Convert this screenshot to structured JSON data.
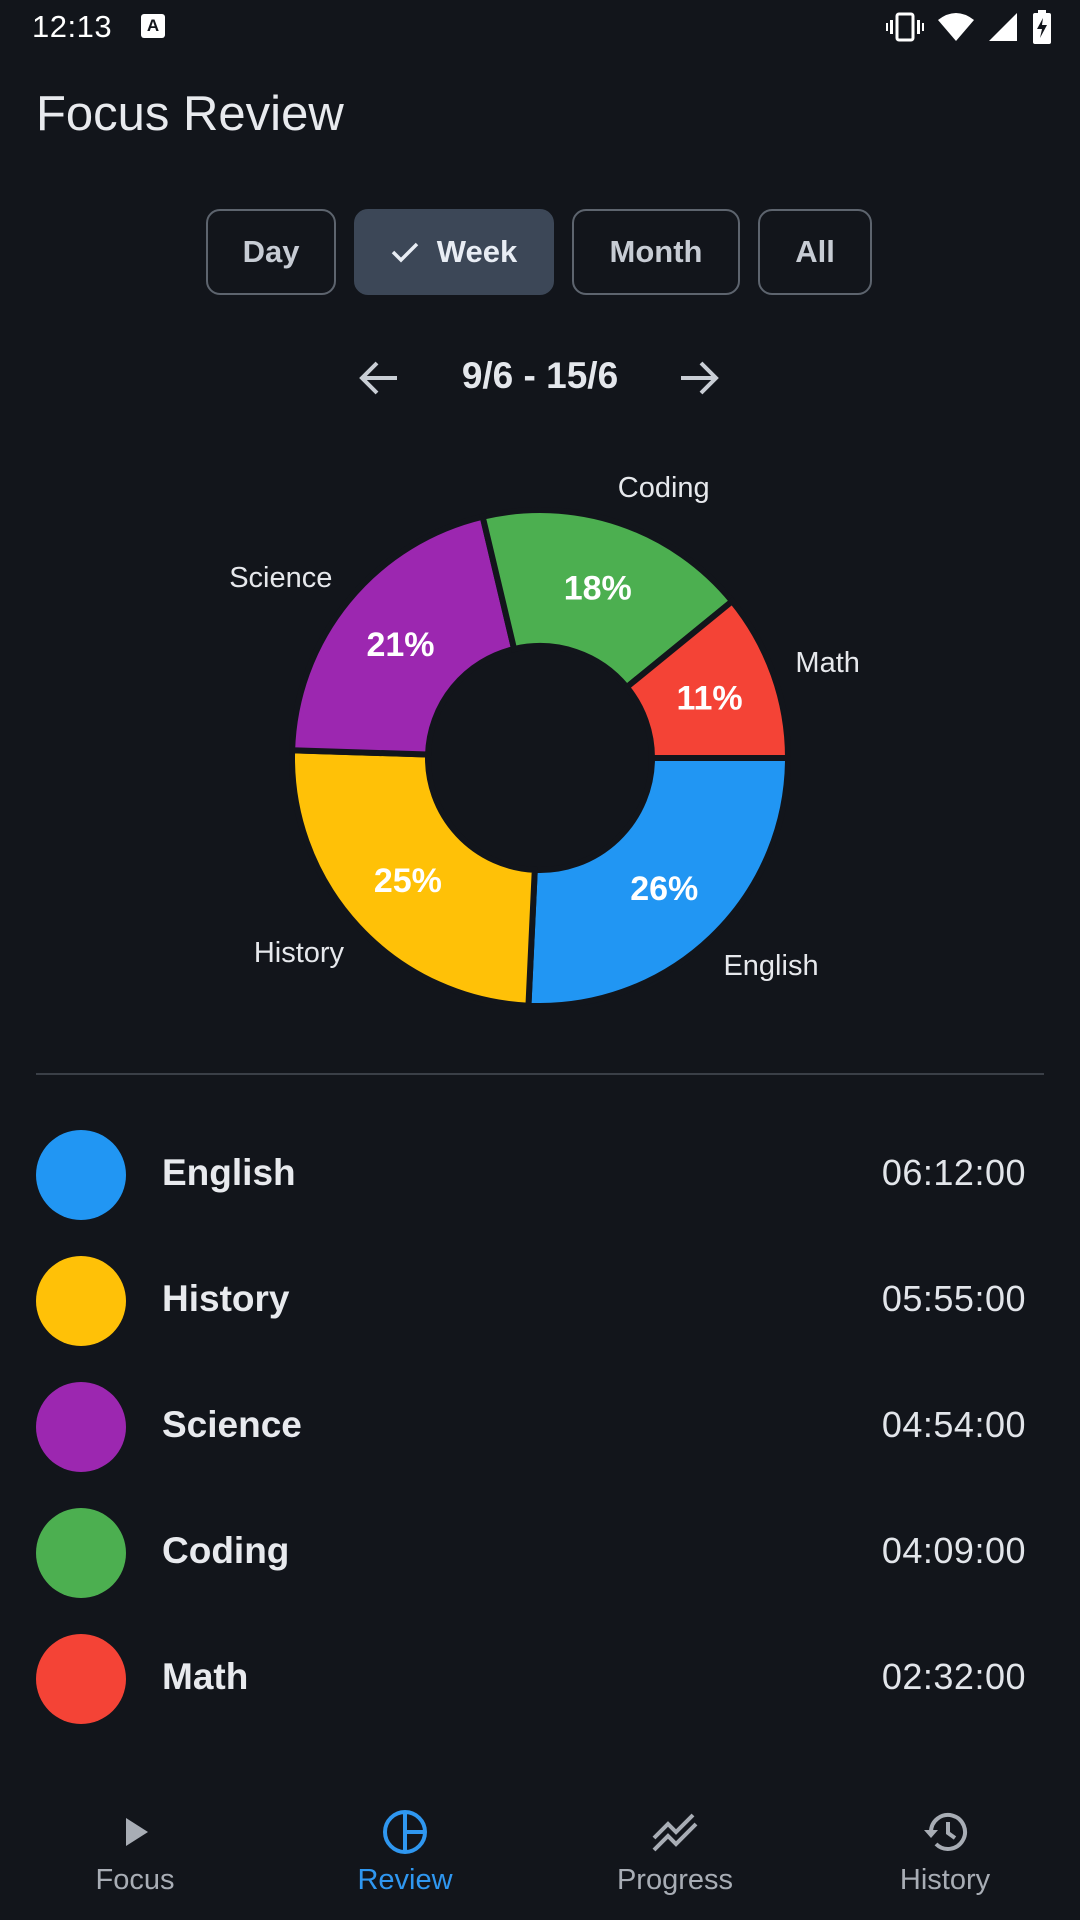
{
  "status_bar": {
    "time": "12:13",
    "notification_badge": "A"
  },
  "header": {
    "title": "Focus Review"
  },
  "filters": {
    "options": [
      "Day",
      "Week",
      "Month",
      "All"
    ],
    "selected": "Week"
  },
  "range": {
    "label": "9/6 - 15/6"
  },
  "chart_data": {
    "type": "pie",
    "variant": "donut",
    "slices": [
      {
        "label": "English",
        "percent": 26,
        "percent_label": "26%",
        "color": "#2196f3"
      },
      {
        "label": "History",
        "percent": 25,
        "percent_label": "25%",
        "color": "#ffc107"
      },
      {
        "label": "Science",
        "percent": 21,
        "percent_label": "21%",
        "color": "#9c27b0"
      },
      {
        "label": "Coding",
        "percent": 18,
        "percent_label": "18%",
        "color": "#4caf50"
      },
      {
        "label": "Math",
        "percent": 11,
        "percent_label": "11%",
        "color": "#f44336"
      }
    ]
  },
  "legend": [
    {
      "name": "English",
      "time": "06:12:00",
      "color": "#2196f3"
    },
    {
      "name": "History",
      "time": "05:55:00",
      "color": "#ffc107"
    },
    {
      "name": "Science",
      "time": "04:54:00",
      "color": "#9c27b0"
    },
    {
      "name": "Coding",
      "time": "04:09:00",
      "color": "#4caf50"
    },
    {
      "name": "Math",
      "time": "02:32:00",
      "color": "#f44336"
    }
  ],
  "bottom_nav": {
    "items": [
      {
        "label": "Focus",
        "icon": "play-icon"
      },
      {
        "label": "Review",
        "icon": "pie-chart-icon"
      },
      {
        "label": "Progress",
        "icon": "trending-icon"
      },
      {
        "label": "History",
        "icon": "history-icon"
      }
    ],
    "active": "Review"
  },
  "colors": {
    "background": "#12151b",
    "accent": "#2f97f0",
    "selected_segment": "#3c4757"
  }
}
